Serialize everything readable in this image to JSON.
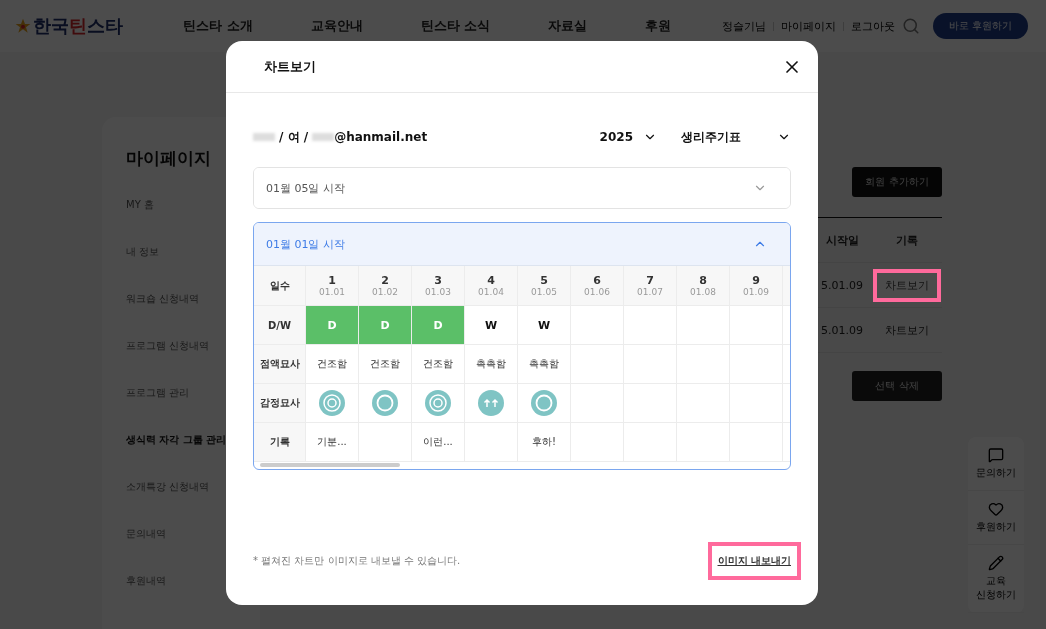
{
  "header": {
    "logo": [
      {
        "text": "한국",
        "accent": false
      },
      {
        "text": "틴",
        "accent": true
      },
      {
        "text": "스타",
        "accent": false
      }
    ],
    "nav": [
      "틴스타 소개",
      "교육안내",
      "틴스타 소식",
      "자료실",
      "후원"
    ],
    "user_links": [
      "정슬기님",
      "마이페이지",
      "로그아웃"
    ],
    "donate_button": "바로 후원하기"
  },
  "sidebar": {
    "title": "마이페이지",
    "items": [
      {
        "label": "MY 홈",
        "selected": false
      },
      {
        "label": "내 정보",
        "selected": false
      },
      {
        "label": "워크숍 신청내역",
        "selected": false
      },
      {
        "label": "프로그램 신청내역",
        "selected": false
      },
      {
        "label": "프로그램 관리",
        "selected": false
      },
      {
        "label": "생식력 자각 그룹 관리",
        "selected": true
      },
      {
        "label": "소개특강 신청내역",
        "selected": false
      },
      {
        "label": "문의내역",
        "selected": false
      },
      {
        "label": "후원내역",
        "selected": false
      }
    ]
  },
  "content": {
    "add_button": "회원 추가하기",
    "columns": [
      "시작일",
      "기록"
    ],
    "rows": [
      {
        "date": "5.01.09",
        "action": "차트보기",
        "highlighted": true
      },
      {
        "date": "5.01.09",
        "action": "차트보기",
        "highlighted": false
      }
    ],
    "delete_button": "선택 삭제"
  },
  "quick_menu": [
    {
      "kind": "inquiry",
      "label": "문의하기"
    },
    {
      "kind": "donate",
      "label": "후원하기"
    },
    {
      "kind": "apply",
      "label": "교육\n신청하기"
    }
  ],
  "modal": {
    "title": "차트보기",
    "user": {
      "gender": "/ 여 /",
      "email": "@hanmail.net"
    },
    "year": "2025",
    "chart_type": "생리주기표",
    "cycles": [
      {
        "label": "01월 05일 시작",
        "expanded": false
      },
      {
        "label": "01월 01일 시작",
        "expanded": true
      }
    ],
    "row_labels": [
      "일수",
      "D/W",
      "점액묘사",
      "감정묘사",
      "기록"
    ],
    "days": [
      {
        "day": "1",
        "date": "01.01",
        "dw": "D",
        "mucus": "건조함",
        "kind": "double-circle",
        "note": "기분..."
      },
      {
        "day": "2",
        "date": "01.02",
        "dw": "D",
        "mucus": "건조함",
        "kind": "circle"
      },
      {
        "day": "3",
        "date": "01.03",
        "dw": "D",
        "mucus": "건조함",
        "kind": "double-circle",
        "note": "이런..."
      },
      {
        "day": "4",
        "date": "01.04",
        "dw": "W",
        "mucus": "촉촉함",
        "kind": "arrows"
      },
      {
        "day": "5",
        "date": "01.05",
        "dw": "W",
        "mucus": "촉촉함",
        "kind": "circle",
        "note": "후하!"
      },
      {
        "day": "6",
        "date": "01.06"
      },
      {
        "day": "7",
        "date": "01.07"
      },
      {
        "day": "8",
        "date": "01.08"
      },
      {
        "day": "9",
        "date": "01.09"
      }
    ],
    "footnote": "* 펼쳐진 차트만 이미지로 내보낼 수 있습니다.",
    "export_button": {
      "label": "이미지 내보내기",
      "highlighted": true
    }
  }
}
